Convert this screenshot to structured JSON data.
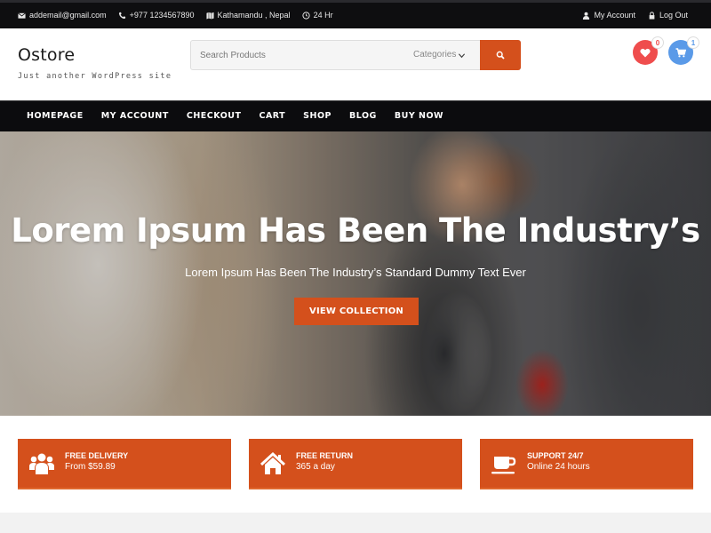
{
  "topbar": {
    "email": "addemail@gmail.com",
    "phone": "+977 1234567890",
    "location": "Kathamandu , Nepal",
    "hours": "24 Hr",
    "my_account": "My Account",
    "logout": "Log Out"
  },
  "header": {
    "brand": "Ostore",
    "tagline": "Just another WordPress site",
    "search_placeholder": "Search Products",
    "categories_label": "Categories",
    "wishlist_count": "0",
    "cart_count": "1"
  },
  "nav": {
    "items": [
      "HOMEPAGE",
      "MY ACCOUNT",
      "CHECKOUT",
      "CART",
      "SHOP",
      "BLOG",
      "BUY NOW"
    ]
  },
  "hero": {
    "title": "Lorem Ipsum Has Been The Industry’s",
    "subtitle": "Lorem Ipsum Has Been The Industry’s Standard Dummy Text Ever",
    "button": "VIEW COLLECTION"
  },
  "features": [
    {
      "icon": "users-icon",
      "title": "FREE DELIVERY",
      "subtitle": "From $59.89"
    },
    {
      "icon": "home-icon",
      "title": "FREE RETURN",
      "subtitle": "365 a day"
    },
    {
      "icon": "coffee-icon",
      "title": "SUPPORT 24/7",
      "subtitle": "Online 24 hours"
    }
  ],
  "colors": {
    "accent": "#d4501c",
    "topbar_bg": "#0e0e10",
    "nav_bg": "#0c0c0e",
    "wishlist": "#ef4d4d",
    "cart": "#5a9ae8"
  }
}
